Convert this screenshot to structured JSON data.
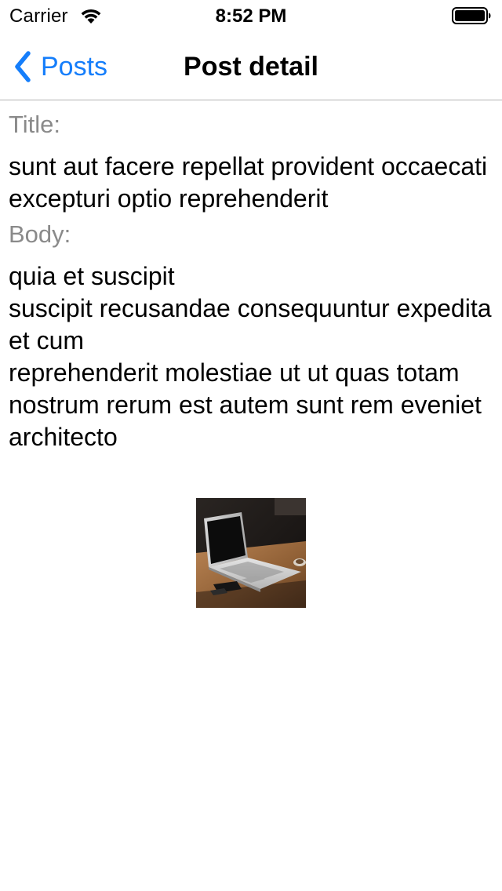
{
  "status_bar": {
    "carrier": "Carrier",
    "time": "8:52 PM",
    "wifi_icon": "wifi-icon",
    "battery_icon": "battery-full-icon"
  },
  "nav": {
    "back_label": "Posts",
    "back_icon": "chevron-left-icon",
    "title": "Post detail",
    "accent_color": "#157efb"
  },
  "post": {
    "title_label": "Title:",
    "title_value": "sunt aut facere repellat provident occaecati excepturi optio reprehenderit",
    "body_label": "Body:",
    "body_value": "quia et suscipit\nsuscipit recusandae consequuntur expedita et cum\nreprehenderit molestiae ut ut quas totam\nnostrum rerum est autem sunt rem eveniet architecto",
    "image_subject": "laptop-on-desk"
  }
}
